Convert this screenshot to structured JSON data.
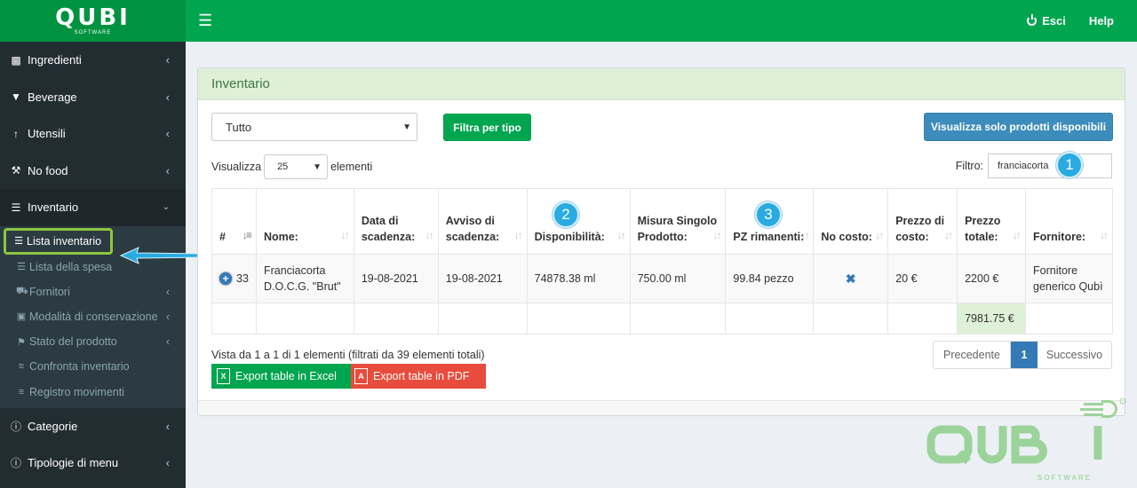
{
  "brand": {
    "name": "QUBI",
    "sub": "SOFTWARE"
  },
  "topbar": {
    "menu_icon": "hamburger-icon",
    "logout_label": "Esci",
    "help_label": "Help"
  },
  "sidebar": {
    "items": [
      {
        "label": "Ingredienti",
        "icon": "puzzle-icon"
      },
      {
        "label": "Beverage",
        "icon": "cocktail-icon"
      },
      {
        "label": "Utensili",
        "icon": "cutlery-icon"
      },
      {
        "label": "No food",
        "icon": "wrench-icon"
      },
      {
        "label": "Inventario",
        "icon": "list-icon"
      }
    ],
    "subitems": [
      {
        "label": "Lista inventario",
        "icon": "list-icon"
      },
      {
        "label": "Lista della spesa",
        "icon": "list-icon"
      },
      {
        "label": "Fornitori",
        "icon": "truck-icon"
      },
      {
        "label": "Modalità di conservazione",
        "icon": "cube-icon"
      },
      {
        "label": "Stato del prodotto",
        "icon": "flag-icon"
      },
      {
        "label": "Confronta inventario",
        "icon": "bars-icon"
      },
      {
        "label": "Registro movimenti",
        "icon": "bars-icon"
      }
    ],
    "bottom_items": [
      {
        "label": "Categorie",
        "icon": "info-icon"
      },
      {
        "label": "Tipologie di menu",
        "icon": "info-icon"
      }
    ]
  },
  "panel": {
    "title": "Inventario",
    "type_select": "Tutto",
    "filter_button": "Filtra per tipo",
    "available_button": "Visualizza solo prodotti disponibili",
    "length_prefix": "Visualizza",
    "length_value": "25",
    "length_suffix": "elementi",
    "filter_label": "Filtro:",
    "filter_value": "franciacorta",
    "badges": [
      "1",
      "2",
      "3"
    ],
    "columns": [
      "#",
      "Nome:",
      "Data di scadenza:",
      "Avviso di scadenza:",
      "Disponibilità:",
      "Misura Singolo Prodotto:",
      "PZ rimanenti:",
      "No costo:",
      "Prezzo di costo:",
      "Prezzo totale:",
      "Fornitore:"
    ],
    "row": {
      "id": "33",
      "name": "Franciacorta D.O.C.G. \"Brut\"",
      "expiry": "19-08-2021",
      "warning": "19-08-2021",
      "availability": "74878.38 ml",
      "unit_size": "750.00 ml",
      "pieces": "99.84 pezzo",
      "no_cost": "✖",
      "cost_price": "20 €",
      "total_price": "2200 €",
      "supplier": "Fornitore generico Qubì"
    },
    "grand_total": "7981.75 €",
    "info": "Vista da 1 a 1 di 1 elementi (filtrati da 39 elementi totali)",
    "export_excel": "Export table in Excel",
    "export_pdf": "Export table in PDF",
    "pager": {
      "prev": "Precedente",
      "current": "1",
      "next": "Successivo"
    }
  },
  "colors": {
    "brand_green": "#00a54f",
    "sidebar_bg": "#222d32",
    "accent_blue": "#3c8dbc",
    "pdf_red": "#e74c3c",
    "badge_blue": "#29abe2"
  }
}
